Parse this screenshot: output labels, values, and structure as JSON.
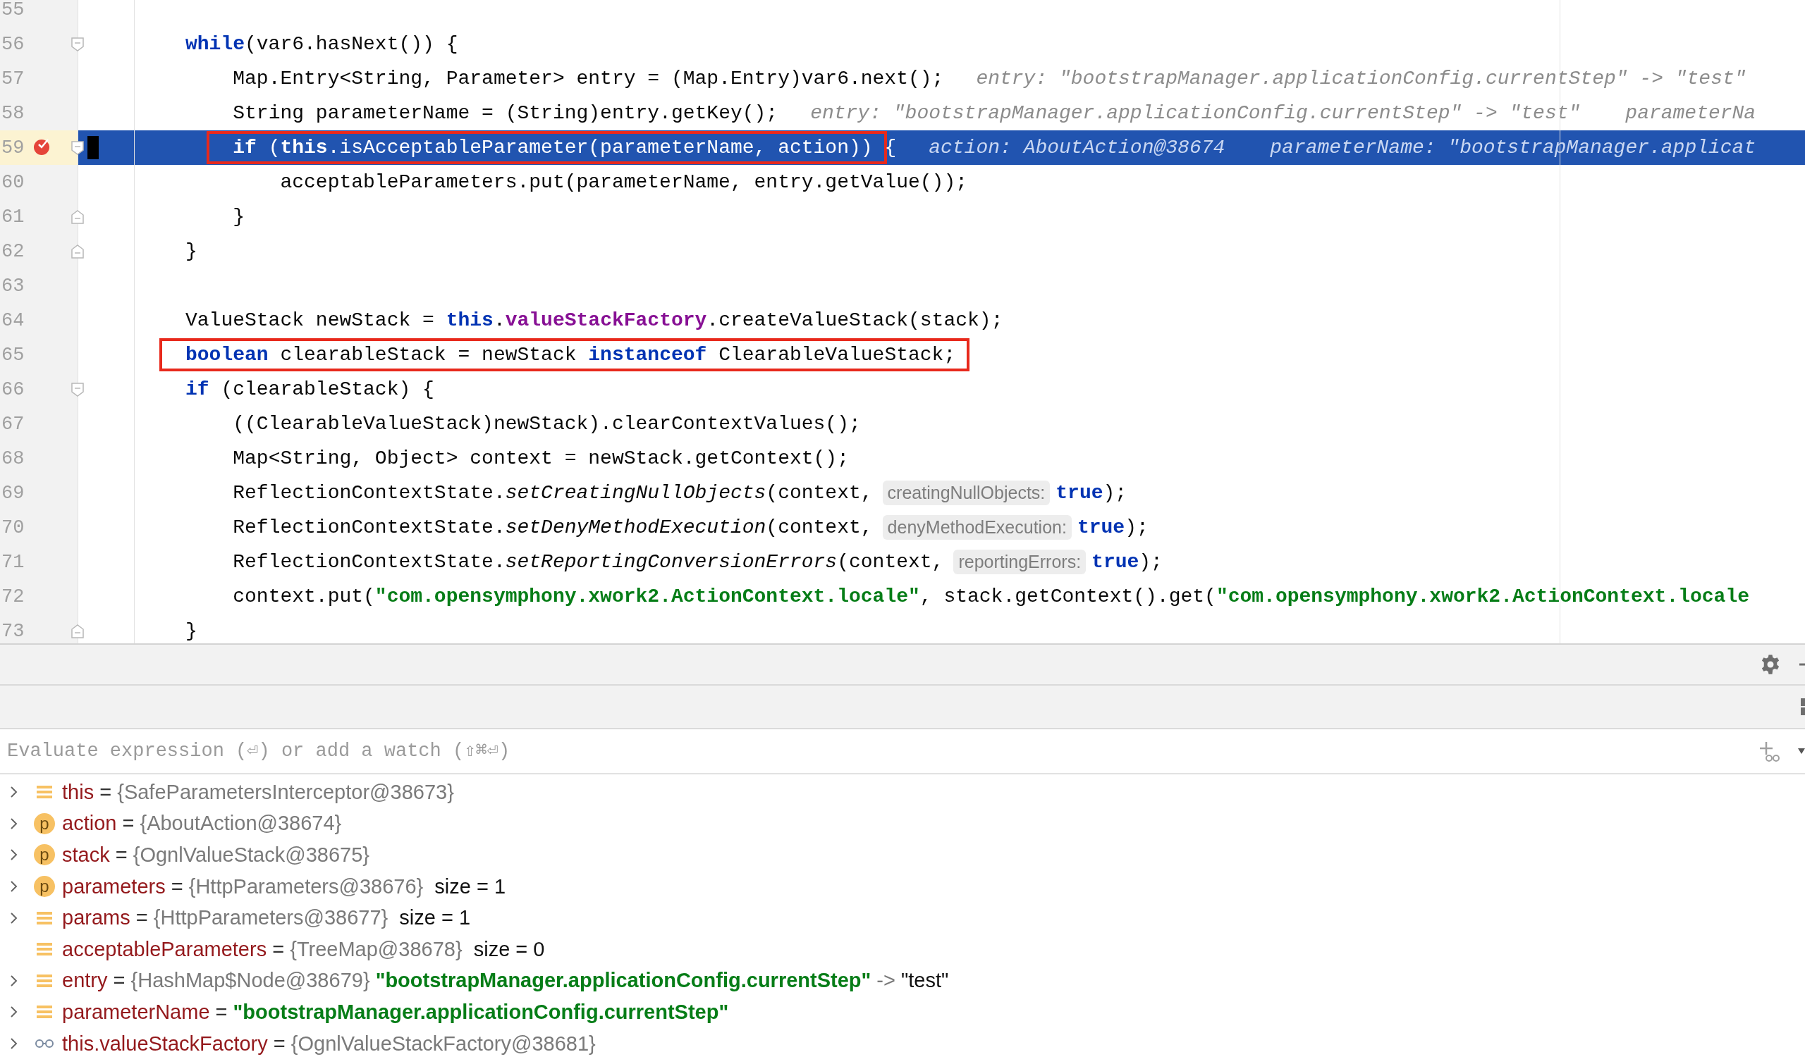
{
  "editor": {
    "lines": [
      {
        "number": "55",
        "current": false,
        "breakpoint": false,
        "fold_start": false,
        "fold_end": false
      },
      {
        "number": "56",
        "current": false,
        "breakpoint": false,
        "fold_start": true,
        "fold_end": false,
        "parts": [
          {
            "kind": "code",
            "boxed": false,
            "tokens": [
              {
                "kind": "keyword",
                "text": "while"
              },
              {
                "kind": "plain",
                "text": "(var6.hasNext()) {"
              }
            ]
          }
        ]
      },
      {
        "number": "57",
        "current": false,
        "breakpoint": false,
        "fold_start": false,
        "fold_end": false,
        "parts": [
          {
            "kind": "code",
            "boxed": false,
            "tokens": [
              {
                "kind": "plain",
                "text": "    Map.Entry<String, Parameter> entry = (Map.Entry)var6.next();"
              }
            ]
          },
          {
            "kind": "value",
            "text": "entry: \"bootstrapManager.applicationConfig.currentStep\" -> \"test\""
          }
        ]
      },
      {
        "number": "58",
        "current": false,
        "breakpoint": false,
        "fold_start": false,
        "fold_end": false,
        "parts": [
          {
            "kind": "code",
            "boxed": false,
            "tokens": [
              {
                "kind": "plain",
                "text": "    String parameterName = (String)entry.getKey();"
              }
            ]
          },
          {
            "kind": "value",
            "text": "entry: \"bootstrapManager.applicationConfig.currentStep\" -> \"test\""
          },
          {
            "kind": "value",
            "text": "parameterNa"
          }
        ]
      },
      {
        "number": "59",
        "current": true,
        "breakpoint": true,
        "fold_start": true,
        "fold_end": false,
        "parts": [
          {
            "kind": "code",
            "boxed": true,
            "tokens": [
              {
                "kind": "keyword",
                "text": "    if"
              },
              {
                "kind": "plain",
                "text": " ("
              },
              {
                "kind": "keyword",
                "text": "this"
              },
              {
                "kind": "plain",
                "text": ".isAcceptableParameter(parameterName, action))"
              }
            ]
          },
          {
            "kind": "code",
            "boxed": false,
            "tokens": [
              {
                "kind": "plain",
                "text": " {"
              }
            ]
          },
          {
            "kind": "value",
            "text": "action: AboutAction@38674"
          },
          {
            "kind": "value",
            "text": "parameterName: \"bootstrapManager.applicat"
          }
        ]
      },
      {
        "number": "60",
        "current": false,
        "breakpoint": false,
        "fold_start": false,
        "fold_end": false,
        "parts": [
          {
            "kind": "code",
            "boxed": false,
            "tokens": [
              {
                "kind": "plain",
                "text": "        acceptableParameters.put(parameterName, entry.getValue());"
              }
            ]
          }
        ]
      },
      {
        "number": "61",
        "current": false,
        "breakpoint": false,
        "fold_start": false,
        "fold_end": true,
        "parts": [
          {
            "kind": "code",
            "boxed": false,
            "tokens": [
              {
                "kind": "plain",
                "text": "    }"
              }
            ]
          }
        ]
      },
      {
        "number": "62",
        "current": false,
        "breakpoint": false,
        "fold_start": false,
        "fold_end": true,
        "parts": [
          {
            "kind": "code",
            "boxed": false,
            "tokens": [
              {
                "kind": "plain",
                "text": "}"
              }
            ]
          }
        ]
      },
      {
        "number": "63",
        "current": false,
        "breakpoint": false,
        "fold_start": false,
        "fold_end": false
      },
      {
        "number": "64",
        "current": false,
        "breakpoint": false,
        "fold_start": false,
        "fold_end": false,
        "parts": [
          {
            "kind": "code",
            "boxed": false,
            "tokens": [
              {
                "kind": "plain",
                "text": "ValueStack newStack = "
              },
              {
                "kind": "keyword",
                "text": "this"
              },
              {
                "kind": "plain",
                "text": "."
              },
              {
                "kind": "field",
                "text": "valueStackFactory"
              },
              {
                "kind": "plain",
                "text": ".createValueStack(stack);"
              }
            ]
          }
        ]
      },
      {
        "number": "65",
        "current": false,
        "breakpoint": false,
        "fold_start": false,
        "fold_end": false,
        "parts": [
          {
            "kind": "code",
            "boxed": true,
            "tokens": [
              {
                "kind": "keyword",
                "text": "boolean"
              },
              {
                "kind": "plain",
                "text": " clearableStack = newStack "
              },
              {
                "kind": "keyword",
                "text": "instanceof"
              },
              {
                "kind": "plain",
                "text": " ClearableValueStack;"
              }
            ]
          }
        ]
      },
      {
        "number": "66",
        "current": false,
        "breakpoint": false,
        "fold_start": true,
        "fold_end": false,
        "parts": [
          {
            "kind": "code",
            "boxed": false,
            "tokens": [
              {
                "kind": "keyword",
                "text": "if"
              },
              {
                "kind": "plain",
                "text": " (clearableStack) {"
              }
            ]
          }
        ]
      },
      {
        "number": "67",
        "current": false,
        "breakpoint": false,
        "fold_start": false,
        "fold_end": false,
        "parts": [
          {
            "kind": "code",
            "boxed": false,
            "tokens": [
              {
                "kind": "plain",
                "text": "    ((ClearableValueStack)newStack).clearContextValues();"
              }
            ]
          }
        ]
      },
      {
        "number": "68",
        "current": false,
        "breakpoint": false,
        "fold_start": false,
        "fold_end": false,
        "parts": [
          {
            "kind": "code",
            "boxed": false,
            "tokens": [
              {
                "kind": "plain",
                "text": "    Map<String, Object> context = newStack.getContext();"
              }
            ]
          }
        ]
      },
      {
        "number": "69",
        "current": false,
        "breakpoint": false,
        "fold_start": false,
        "fold_end": false,
        "parts": [
          {
            "kind": "code",
            "boxed": false,
            "tokens": [
              {
                "kind": "plain",
                "text": "    ReflectionContextState."
              },
              {
                "kind": "static",
                "text": "setCreatingNullObjects"
              },
              {
                "kind": "plain",
                "text": "(context,"
              }
            ]
          },
          {
            "kind": "hint",
            "text": "creatingNullObjects:"
          },
          {
            "kind": "code",
            "boxed": false,
            "tokens": [
              {
                "kind": "keyword",
                "text": "true"
              },
              {
                "kind": "plain",
                "text": ");"
              }
            ]
          }
        ]
      },
      {
        "number": "70",
        "current": false,
        "breakpoint": false,
        "fold_start": false,
        "fold_end": false,
        "parts": [
          {
            "kind": "code",
            "boxed": false,
            "tokens": [
              {
                "kind": "plain",
                "text": "    ReflectionContextState."
              },
              {
                "kind": "static",
                "text": "setDenyMethodExecution"
              },
              {
                "kind": "plain",
                "text": "(context,"
              }
            ]
          },
          {
            "kind": "hint",
            "text": "denyMethodExecution:"
          },
          {
            "kind": "code",
            "boxed": false,
            "tokens": [
              {
                "kind": "keyword",
                "text": "true"
              },
              {
                "kind": "plain",
                "text": ");"
              }
            ]
          }
        ]
      },
      {
        "number": "71",
        "current": false,
        "breakpoint": false,
        "fold_start": false,
        "fold_end": false,
        "parts": [
          {
            "kind": "code",
            "boxed": false,
            "tokens": [
              {
                "kind": "plain",
                "text": "    ReflectionContextState."
              },
              {
                "kind": "static",
                "text": "setReportingConversionErrors"
              },
              {
                "kind": "plain",
                "text": "(context,"
              }
            ]
          },
          {
            "kind": "hint",
            "text": "reportingErrors:"
          },
          {
            "kind": "code",
            "boxed": false,
            "tokens": [
              {
                "kind": "keyword",
                "text": "true"
              },
              {
                "kind": "plain",
                "text": ");"
              }
            ]
          }
        ]
      },
      {
        "number": "72",
        "current": false,
        "breakpoint": false,
        "fold_start": false,
        "fold_end": false,
        "parts": [
          {
            "kind": "code",
            "boxed": false,
            "tokens": [
              {
                "kind": "plain",
                "text": "    context.put("
              },
              {
                "kind": "string",
                "text": "\"com.opensymphony.xwork2.ActionContext.locale\""
              },
              {
                "kind": "plain",
                "text": ", stack.getContext().get("
              },
              {
                "kind": "string",
                "text": "\"com.opensymphony.xwork2.ActionContext.locale"
              }
            ]
          }
        ]
      },
      {
        "number": "73",
        "current": false,
        "breakpoint": false,
        "fold_start": false,
        "fold_end": true,
        "parts": [
          {
            "kind": "code",
            "boxed": false,
            "tokens": [
              {
                "kind": "plain",
                "text": "}"
              }
            ]
          }
        ]
      }
    ]
  },
  "watch_field": {
    "placeholder": "Evaluate expression (⏎) or add a watch (⇧⌘⏎)"
  },
  "variables": [
    {
      "expandable": true,
      "kind": "field",
      "name": "this",
      "value": [
        {
          "kind": "op",
          "text": "="
        },
        {
          "kind": "ref",
          "text": "{SafeParametersInterceptor@38673}"
        }
      ]
    },
    {
      "expandable": true,
      "kind": "param",
      "icon_label": "p",
      "name": "action",
      "value": [
        {
          "kind": "op",
          "text": "="
        },
        {
          "kind": "ref",
          "text": "{AboutAction@38674}"
        }
      ]
    },
    {
      "expandable": true,
      "kind": "param",
      "icon_label": "p",
      "name": "stack",
      "value": [
        {
          "kind": "op",
          "text": "="
        },
        {
          "kind": "ref",
          "text": "{OgnlValueStack@38675}"
        }
      ]
    },
    {
      "expandable": true,
      "kind": "param",
      "icon_label": "p",
      "name": "parameters",
      "value": [
        {
          "kind": "op",
          "text": "="
        },
        {
          "kind": "ref",
          "text": "{HttpParameters@38676}"
        },
        {
          "kind": "size",
          "text": "size = 1"
        }
      ]
    },
    {
      "expandable": true,
      "kind": "field",
      "name": "params",
      "value": [
        {
          "kind": "op",
          "text": "="
        },
        {
          "kind": "ref",
          "text": "{HttpParameters@38677}"
        },
        {
          "kind": "size",
          "text": "size = 1"
        }
      ]
    },
    {
      "expandable": false,
      "kind": "field",
      "name": "acceptableParameters",
      "value": [
        {
          "kind": "op",
          "text": "="
        },
        {
          "kind": "ref",
          "text": "{TreeMap@38678}"
        },
        {
          "kind": "size",
          "text": "size = 0"
        }
      ]
    },
    {
      "expandable": true,
      "kind": "field",
      "name": "entry",
      "value": [
        {
          "kind": "op",
          "text": "="
        },
        {
          "kind": "ref",
          "text": "{HashMap$Node@38679}"
        },
        {
          "kind": "string",
          "text": "\"bootstrapManager.applicationConfig.currentStep\""
        },
        {
          "kind": "ref",
          "text": "->"
        },
        {
          "kind": "plain",
          "text": "\"test\""
        }
      ]
    },
    {
      "expandable": true,
      "kind": "field",
      "name": "parameterName",
      "value": [
        {
          "kind": "op",
          "text": "="
        },
        {
          "kind": "string",
          "text": "\"bootstrapManager.applicationConfig.currentStep\""
        }
      ]
    },
    {
      "expandable": true,
      "kind": "watch",
      "name": "this.valueStackFactory",
      "value": [
        {
          "kind": "op",
          "text": "="
        },
        {
          "kind": "ref",
          "text": "{OgnlValueStackFactory@38681}"
        }
      ]
    }
  ]
}
